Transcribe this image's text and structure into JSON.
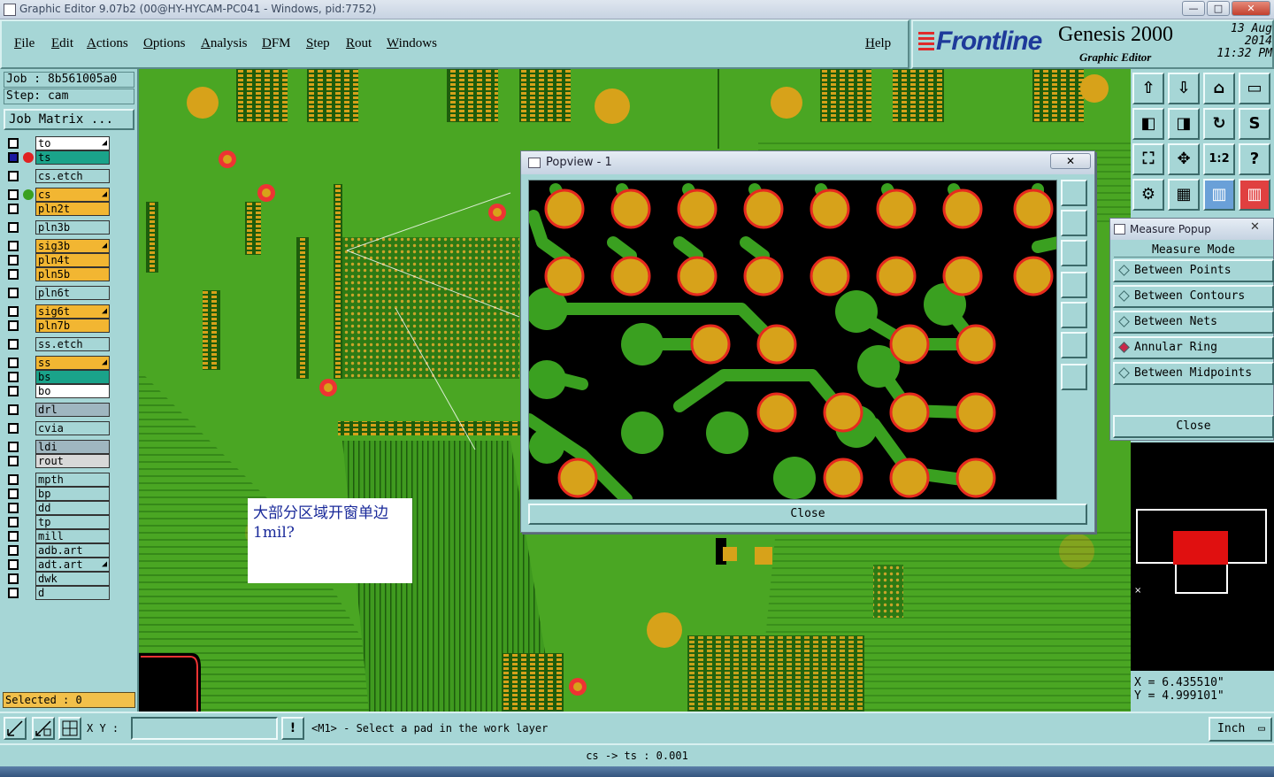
{
  "window": {
    "title": "Graphic Editor 9.07b2 (00@HY-HYCAM-PC041 - Windows, pid:7752)",
    "min": "—",
    "max": "□",
    "close": "✕"
  },
  "menu": [
    "File",
    "Edit",
    "Actions",
    "Options",
    "Analysis",
    "DFM",
    "Step",
    "Rout",
    "Windows"
  ],
  "help": "Help",
  "brand": {
    "logo": "Frontline",
    "product": "Genesis 2000",
    "subtitle": "Graphic Editor",
    "date": "13 Aug 2014",
    "time": "11:32 PM"
  },
  "job": {
    "job": "Job : 8b561005a0",
    "step": "Step: cam",
    "matrix_button": "Job Matrix ..."
  },
  "layers": [
    {
      "name": "to",
      "color": "#ffffff",
      "marker": true
    },
    {
      "name": "ts",
      "color": "#1aa38a",
      "active": true,
      "dot": "#e02222"
    },
    {
      "name": "cs.etch",
      "color": "#a6d6d6"
    },
    {
      "name": "cs",
      "color": "#f2b632",
      "dot": "#3aa020",
      "marker": true
    },
    {
      "name": "pln2t",
      "color": "#f2b632"
    },
    {
      "name": "pln3b",
      "color": "#a6d6d6"
    },
    {
      "name": "sig3b",
      "color": "#f2b632",
      "marker": true
    },
    {
      "name": "pln4t",
      "color": "#f2b632"
    },
    {
      "name": "pln5b",
      "color": "#f2b632"
    },
    {
      "name": "pln6t",
      "color": "#a6d6d6"
    },
    {
      "name": "sig6t",
      "color": "#f2b632",
      "marker": true
    },
    {
      "name": "pln7b",
      "color": "#f2b632"
    },
    {
      "name": "ss.etch",
      "color": "#a6d6d6"
    },
    {
      "name": "ss",
      "color": "#f2b632",
      "marker": true
    },
    {
      "name": "bs",
      "color": "#1aa38a"
    },
    {
      "name": "bo",
      "color": "#ffffff"
    },
    {
      "name": "drl",
      "color": "#9fb6c0"
    },
    {
      "name": "cvia",
      "color": "#a6d6d6"
    },
    {
      "name": "ldi",
      "color": "#9fb6c0"
    },
    {
      "name": "rout",
      "color": "#d8d8d8"
    },
    {
      "name": "mpth",
      "color": "#a6d6d6"
    },
    {
      "name": "bp",
      "color": "#a6d6d6"
    },
    {
      "name": "dd",
      "color": "#a6d6d6"
    },
    {
      "name": "tp",
      "color": "#a6d6d6"
    },
    {
      "name": "mill",
      "color": "#a6d6d6"
    },
    {
      "name": "adb.art",
      "color": "#a6d6d6"
    },
    {
      "name": "adt.art",
      "color": "#a6d6d6",
      "marker": true
    },
    {
      "name": "dwk",
      "color": "#a6d6d6"
    },
    {
      "name": "d",
      "color": "#a6d6d6"
    }
  ],
  "selected": "Selected : 0",
  "popview": {
    "title": "Popview - 1",
    "close": "Close"
  },
  "measure": {
    "title": "Measure Popup",
    "heading": "Measure Mode",
    "options": [
      "Between Points",
      "Between Contours",
      "Between Nets",
      "Annular Ring",
      "Between Midpoints"
    ],
    "selected_index": 3,
    "close": "Close"
  },
  "note": "大部分区域开窗单边1mil?",
  "coords": {
    "x": "X = 6.435510\"",
    "y": "Y = 4.999101\""
  },
  "cmd": {
    "xy_label": "X Y :",
    "xy_value": "",
    "prompt_icon": "!",
    "prompt": "<M1> - Select a pad in the work layer",
    "unit": "Inch"
  },
  "status": "cs -> ts : 0.001",
  "colors": {
    "board": "#4aa623",
    "pad": "#d7a21a",
    "pad_ring": "#e62a1e",
    "ui": "#a6d6d6",
    "brand_blue": "#1e3a9a"
  }
}
